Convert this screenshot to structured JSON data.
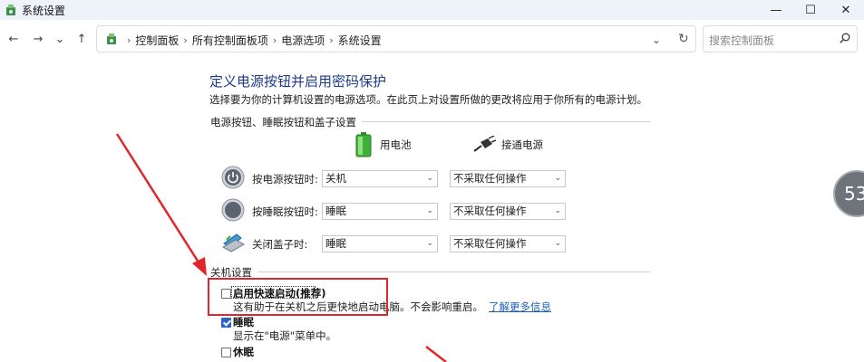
{
  "window": {
    "title": "系统设置",
    "min_glyph": "—",
    "max_glyph": "☐",
    "close_glyph": "✕"
  },
  "nav": {
    "back_glyph": "←",
    "forward_glyph": "→",
    "recent_glyph": "⌄",
    "up_glyph": "↑",
    "breadcrumbs": [
      "控制面板",
      "所有控制面板项",
      "电源选项",
      "系统设置"
    ],
    "crumb_sep": "›",
    "dropdown_glyph": "⌄",
    "refresh_glyph": "↻",
    "search_placeholder": "搜索控制面板"
  },
  "content": {
    "title": "定义电源按钮并启用密码保护",
    "description": "选择要为你的计算机设置的电源选项。在此页上对设置所做的更改将应用于你所有的电源计划。",
    "power_group_label": "电源按钮、睡眠按钮和盖子设置",
    "col_battery": "用电池",
    "col_plugged": "接通电源",
    "rows": [
      {
        "label": "按电源按钮时:",
        "battery": "关机",
        "plugged": "不采取任何操作"
      },
      {
        "label": "按睡眠按钮时:",
        "battery": "睡眠",
        "plugged": "不采取任何操作"
      },
      {
        "label": "关闭盖子时:",
        "battery": "睡眠",
        "plugged": "不采取任何操作"
      }
    ],
    "select_chev": "⌄",
    "shutdown_group_label": "关机设置",
    "fast_startup": {
      "title": "启用快速启动(推荐)",
      "desc": "这有助于在关机之后更快地启动电脑。不会影响重启。",
      "link": "了解更多信息",
      "checked": false
    },
    "sleep": {
      "title": "睡眠",
      "desc": "显示在\"电源\"菜单中。",
      "checked": true
    },
    "hibernate": {
      "title": "休眠",
      "checked": false
    }
  },
  "overlay": {
    "badge": "53",
    "annotation_color": "#e0262a"
  }
}
